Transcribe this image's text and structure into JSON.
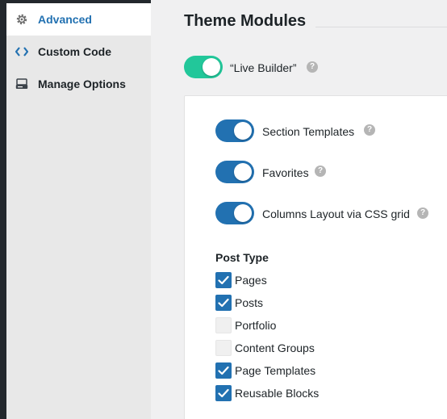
{
  "colors": {
    "accent": "#2271b1",
    "live_builder_toggle": "#22c79a",
    "sidebar_bg": "#e8e8e8",
    "admin_bar": "#23282d"
  },
  "sidebar": {
    "items": [
      {
        "label": "Advanced",
        "icon": "gear-icon",
        "active": true
      },
      {
        "label": "Custom Code",
        "icon": "code-icon",
        "active": false
      },
      {
        "label": "Manage Options",
        "icon": "drive-icon",
        "active": false
      }
    ]
  },
  "main": {
    "title": "Theme Modules",
    "live_builder": {
      "label": "“Live Builder”",
      "on": true,
      "help": "?"
    },
    "toggles": [
      {
        "label": "Section Templates",
        "on": true,
        "help": "?"
      },
      {
        "label": "Favorites",
        "on": true,
        "help": "?"
      },
      {
        "label": "Columns Layout via CSS grid",
        "on": true,
        "help": "?"
      }
    ],
    "post_type": {
      "heading": "Post Type",
      "options": [
        {
          "label": "Pages",
          "checked": true
        },
        {
          "label": "Posts",
          "checked": true
        },
        {
          "label": "Portfolio",
          "checked": false
        },
        {
          "label": "Content Groups",
          "checked": false
        },
        {
          "label": "Page Templates",
          "checked": true
        },
        {
          "label": "Reusable Blocks",
          "checked": true
        }
      ]
    }
  }
}
